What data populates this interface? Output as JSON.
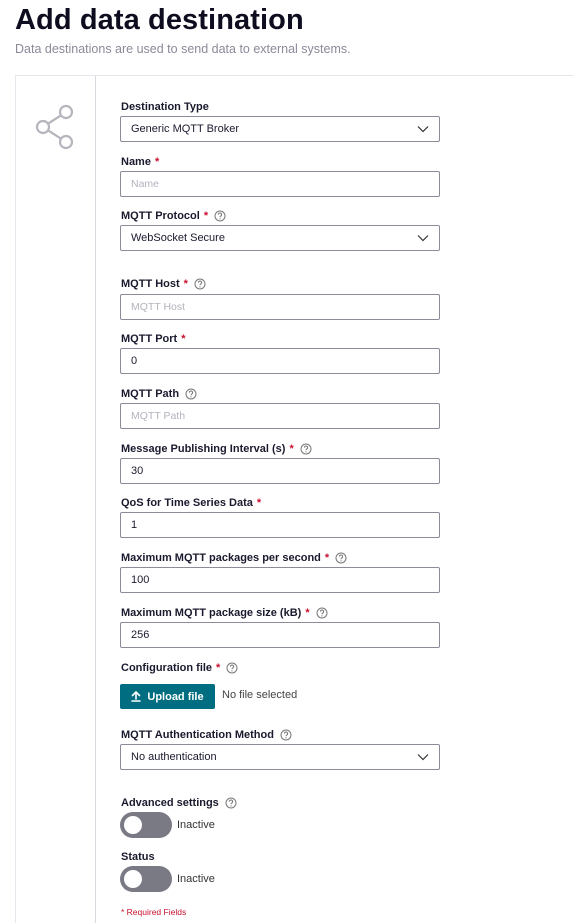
{
  "page": {
    "title": "Add data destination",
    "subtitle": "Data destinations are used to send data to external systems."
  },
  "icons": {
    "destination": "share-icon",
    "help": "help-circle-icon",
    "dropdown": "chevron-down-icon",
    "upload": "upload-arrow-icon"
  },
  "colors": {
    "primary_button": "#006e80",
    "required_marker": "#c8102e",
    "toggle_inactive": "#7a7a85"
  },
  "form": {
    "destination_type": {
      "label": "Destination Type",
      "value": "Generic MQTT Broker"
    },
    "name": {
      "label": "Name",
      "required": "*",
      "placeholder": "Name"
    },
    "mqtt_protocol": {
      "label": "MQTT Protocol",
      "required": "*",
      "value": "WebSocket Secure"
    },
    "mqtt_host": {
      "label": "MQTT Host",
      "required": "*",
      "placeholder": "MQTT Host"
    },
    "mqtt_port": {
      "label": "MQTT Port",
      "required": "*",
      "value": "0"
    },
    "mqtt_path": {
      "label": "MQTT Path",
      "placeholder": "MQTT Path"
    },
    "publishing_interval": {
      "label": "Message Publishing Interval (s)",
      "required": "*",
      "value": "30"
    },
    "qos": {
      "label": "QoS for Time Series Data",
      "required": "*",
      "value": "1"
    },
    "max_packages_per_second": {
      "label": "Maximum MQTT packages per second",
      "required": "*",
      "value": "100"
    },
    "max_package_size": {
      "label": "Maximum MQTT package size (kB)",
      "required": "*",
      "value": "256"
    },
    "configuration_file": {
      "label": "Configuration file",
      "required": "*",
      "button_label": "Upload file",
      "file_status": "No file selected"
    },
    "auth_method": {
      "label": "MQTT Authentication Method",
      "value": "No authentication"
    },
    "advanced_settings": {
      "label": "Advanced settings",
      "state": "Inactive"
    },
    "status": {
      "label": "Status",
      "state": "Inactive"
    }
  },
  "footer": {
    "required_note": "* Required Fields"
  }
}
